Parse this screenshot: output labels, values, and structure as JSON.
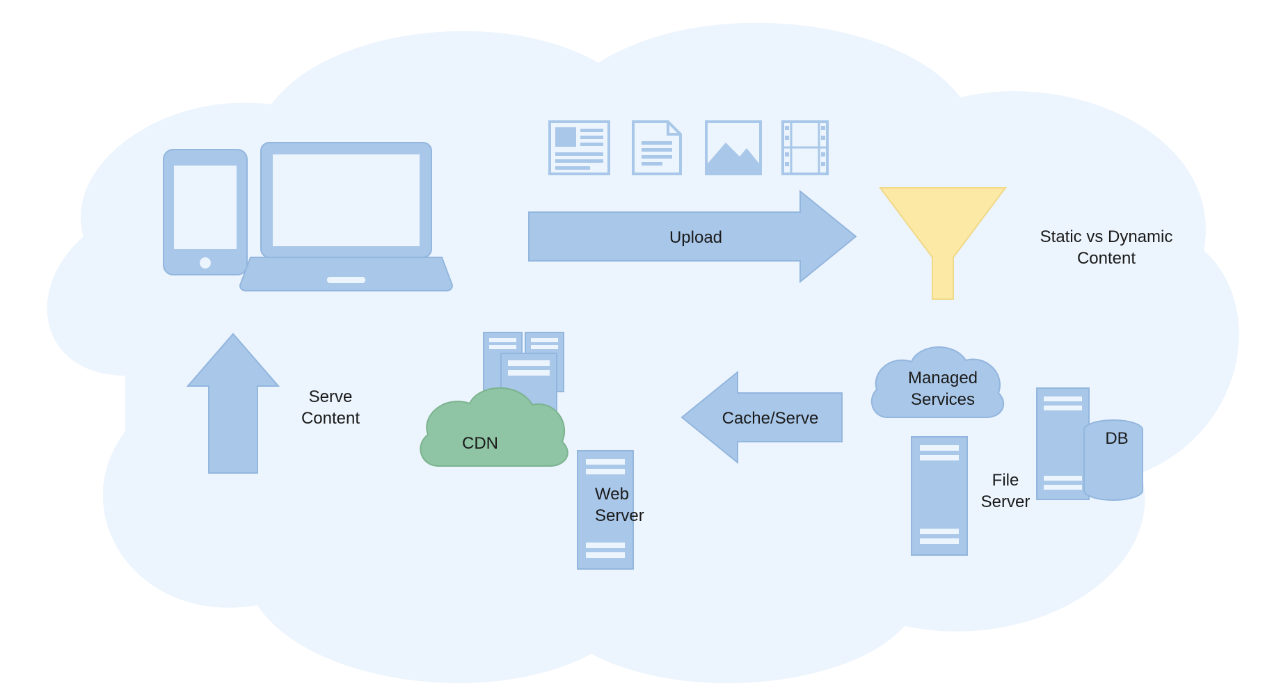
{
  "labels": {
    "upload": "Upload",
    "static_dynamic_l1": "Static vs Dynamic",
    "static_dynamic_l2": "Content",
    "cdn": "CDN",
    "web_server_l1": "Web",
    "web_server_l2": "Server",
    "cache_serve": "Cache/Serve",
    "serve_content_l1": "Serve",
    "serve_content_l2": "Content",
    "managed_services_l1": "Managed",
    "managed_services_l2": "Services",
    "file_server_l1": "File",
    "file_server_l2": "Server",
    "db": "DB"
  },
  "colors": {
    "cloud_bg": "#ecf4fd",
    "shape_fill": "#a9c7e8",
    "shape_stroke": "#93b6de",
    "funnel_fill": "#fde9a6",
    "funnel_stroke": "#f0d987",
    "cdn_cloud_fill": "#8fc4a4",
    "cdn_cloud_stroke": "#7bb38f",
    "screen_inner": "#ecf4fd"
  }
}
